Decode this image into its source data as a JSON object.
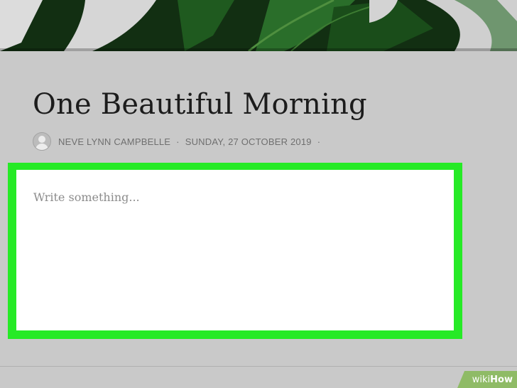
{
  "post": {
    "title": "One Beautiful Morning",
    "author": "NEVE LYNN CAMPBELLE",
    "separator": "·",
    "date": "SUNDAY, 27 OCTOBER 2019",
    "trailing_separator": "·",
    "avatar_icon": "user-avatar-icon"
  },
  "editor": {
    "placeholder": "Write something...",
    "highlight_color": "#26ea26"
  },
  "header_image": {
    "icon": "monstera-leaf-image"
  },
  "watermark": {
    "wiki": "wiki",
    "how": "How"
  }
}
